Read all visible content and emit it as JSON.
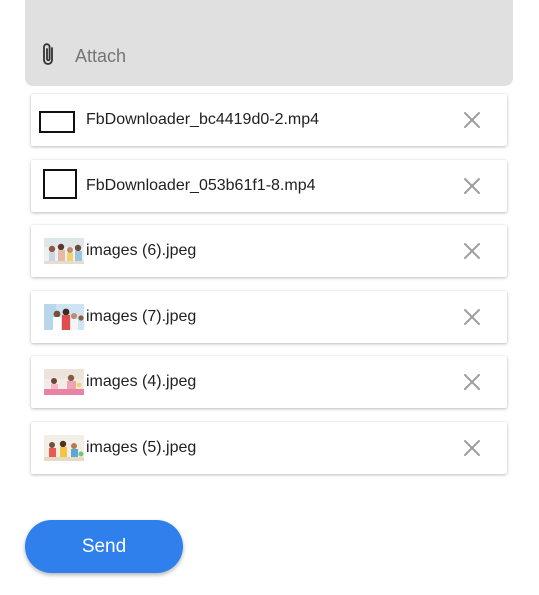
{
  "attach": {
    "label": "Attach",
    "icon": "paperclip-icon"
  },
  "files": [
    {
      "name": "FbDownloader_bc4419d0-2.mp4",
      "type": "video"
    },
    {
      "name": "FbDownloader_053b61f1-8.mp4",
      "type": "video"
    },
    {
      "name": "images (6).jpeg",
      "type": "image"
    },
    {
      "name": "images (7).jpeg",
      "type": "image"
    },
    {
      "name": "images (4).jpeg",
      "type": "image"
    },
    {
      "name": "images (5).jpeg",
      "type": "image"
    }
  ],
  "send": {
    "label": "Send"
  },
  "colors": {
    "accent": "#2f80ed",
    "panel": "#e0e0e0",
    "remove_icon": "#9e9e9e"
  }
}
